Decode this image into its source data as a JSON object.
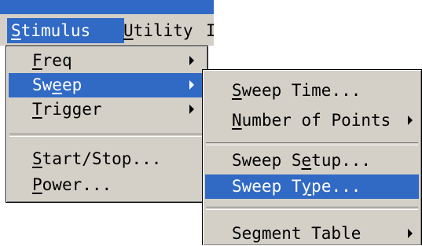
{
  "menubar": {
    "items": [
      {
        "mnemonic": "S",
        "rest": "timulus"
      },
      {
        "mnemonic": "U",
        "rest": "tility"
      },
      {
        "text": "I"
      }
    ]
  },
  "stimulus_menu": {
    "freq": {
      "mnemonic": "F",
      "rest": "req"
    },
    "sweep": {
      "pre": "Sw",
      "mnemonic": "e",
      "post": "ep"
    },
    "trigger": {
      "mnemonic": "T",
      "rest": "rigger"
    },
    "start_stop": {
      "mnemonic": "S",
      "rest": "tart/Stop..."
    },
    "power": {
      "mnemonic": "P",
      "rest": "ower..."
    }
  },
  "sweep_menu": {
    "sweep_time": {
      "mnemonic": "S",
      "rest": "weep Time..."
    },
    "num_points": {
      "mnemonic": "N",
      "rest": "umber of Points"
    },
    "sweep_setup": {
      "pre": "Sweep S",
      "mnemonic": "e",
      "post": "tup..."
    },
    "sweep_type": {
      "pre": "Sweep T",
      "mnemonic": "y",
      "post": "pe..."
    },
    "segment_table": {
      "text": "Segment Table"
    }
  },
  "colors": {
    "highlight": "#316ac5",
    "menu_bg": "#d4d0c8",
    "titlebar": "#3169c6"
  }
}
